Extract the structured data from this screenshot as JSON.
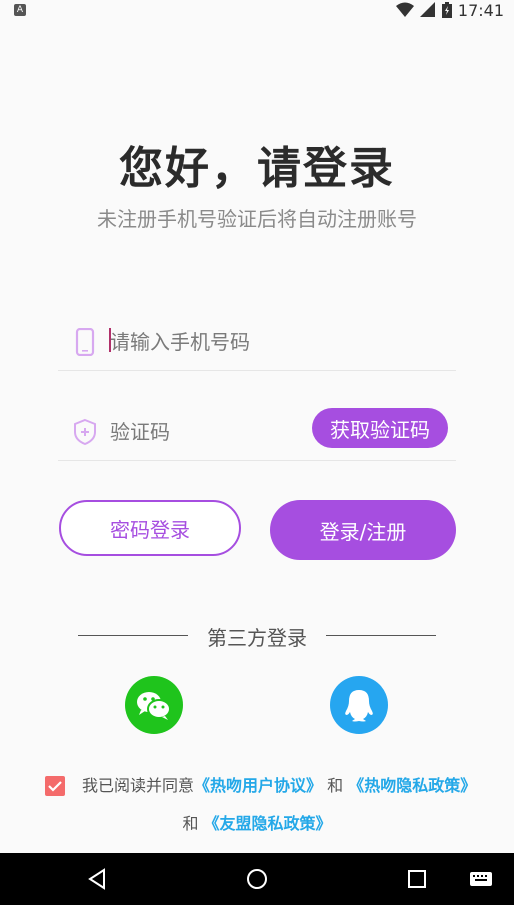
{
  "status_bar": {
    "time": "17:41",
    "notification_letter": "A"
  },
  "header": {
    "title": "您好，请登录",
    "subtitle": "未注册手机号验证后将自动注册账号"
  },
  "phone_field": {
    "placeholder": "请输入手机号码",
    "value": ""
  },
  "code_field": {
    "placeholder": "验证码",
    "value": "",
    "get_code_label": "获取验证码"
  },
  "buttons": {
    "password_login": "密码登录",
    "login_register": "登录/注册"
  },
  "third_party": {
    "label": "第三方登录",
    "providers": [
      {
        "icon": "wechat-icon"
      },
      {
        "icon": "qq-icon"
      }
    ]
  },
  "agreement": {
    "checked": true,
    "prefix": "我已阅读并同意",
    "link1": "《热吻用户协议》",
    "and1": "和",
    "link2": "《热吻隐私政策》",
    "and2": "和",
    "link3": "《友盟隐私政策》"
  },
  "colors": {
    "accent": "#a64ee0",
    "checkbox": "#f46b6b",
    "link": "#24a8e8",
    "wechat": "#1fc41c",
    "qq": "#26a6f0"
  }
}
